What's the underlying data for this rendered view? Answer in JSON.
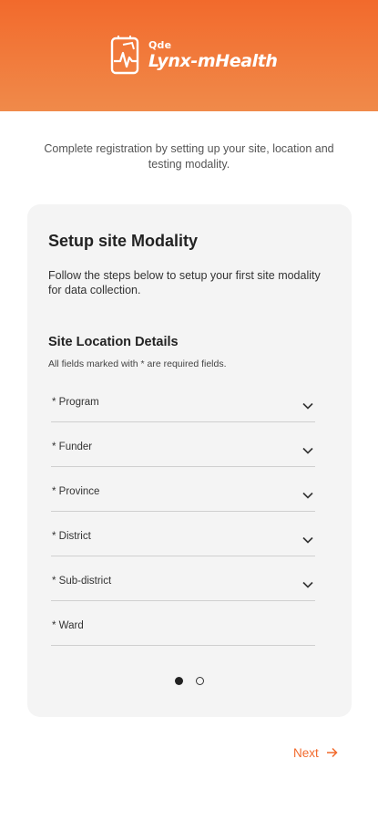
{
  "colors": {
    "brand": "#f26a2c",
    "card_bg": "#f4f4f4"
  },
  "header": {
    "logo_icon": "lynx-logo-icon",
    "brand_sub": "Qde",
    "brand_name": "Lynx-mHealth"
  },
  "intro": {
    "text": "Complete registration by setting up your site, location and testing modality."
  },
  "card": {
    "title": "Setup site Modality",
    "description": "Follow the steps below to setup your first site modality for data collection.",
    "section_title": "Site Location Details",
    "required_note": "All fields marked with * are required fields.",
    "fields": [
      {
        "label": "* Program",
        "has_dropdown": true
      },
      {
        "label": "* Funder",
        "has_dropdown": true
      },
      {
        "label": "* Province",
        "has_dropdown": true
      },
      {
        "label": "* District",
        "has_dropdown": true
      },
      {
        "label": "* Sub-district",
        "has_dropdown": true
      },
      {
        "label": "* Ward",
        "has_dropdown": false
      }
    ],
    "pagination": {
      "current_page": 1,
      "total_pages": 2
    }
  },
  "footer": {
    "next_label": "Next",
    "next_icon": "arrow-right-icon"
  }
}
